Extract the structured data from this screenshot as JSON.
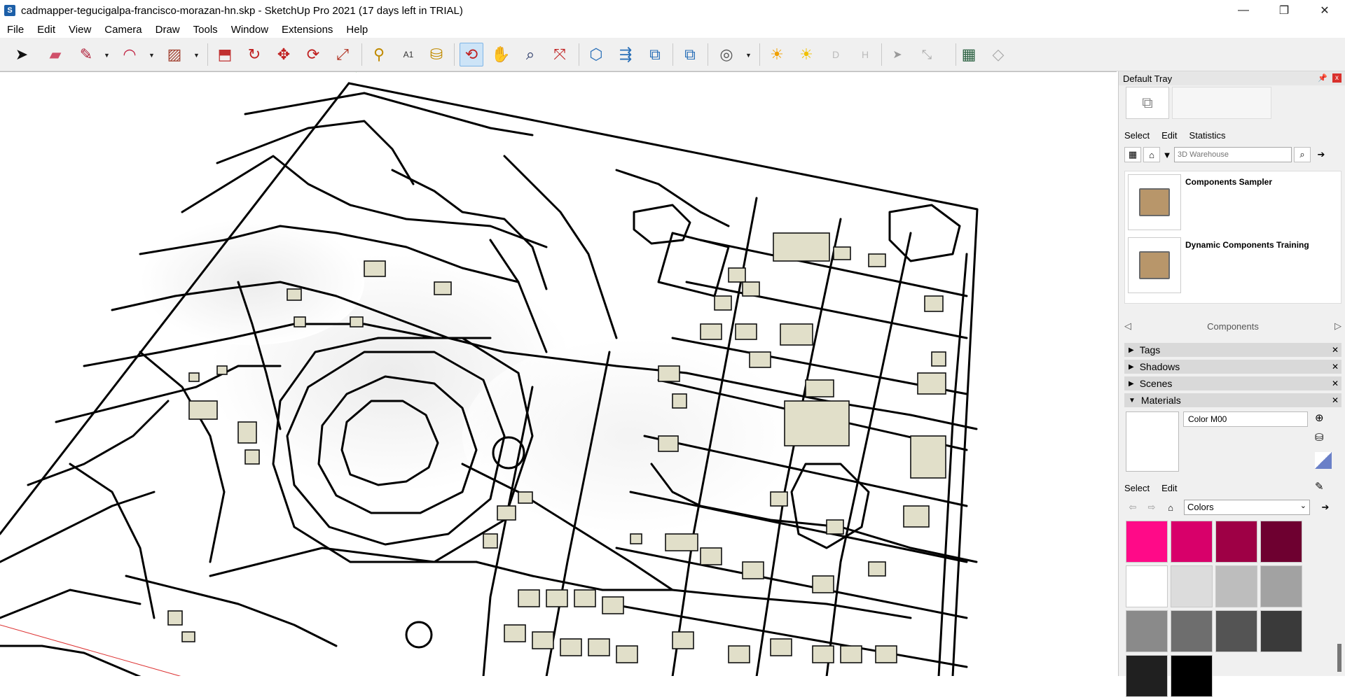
{
  "window": {
    "title": "cadmapper-tegucigalpa-francisco-morazan-hn.skp - SketchUp Pro 2021 (17 days left in TRIAL)",
    "app_icon": "S",
    "minimize": "—",
    "restore": "❐",
    "close": "✕"
  },
  "menu": {
    "items": [
      "File",
      "Edit",
      "View",
      "Camera",
      "Draw",
      "Tools",
      "Window",
      "Extensions",
      "Help"
    ]
  },
  "toolbar": {
    "tools": [
      {
        "name": "select-tool-icon",
        "glyph": "➤"
      },
      {
        "name": "eraser-tool-icon",
        "glyph": "▰"
      },
      {
        "name": "pencil-tool-icon",
        "glyph": "✎"
      },
      {
        "name": "arc-tool-icon",
        "glyph": "◠"
      },
      {
        "name": "rectangle-tool-icon",
        "glyph": "▨"
      },
      {
        "name": "push-pull-tool-icon",
        "glyph": "⬒"
      },
      {
        "name": "follow-me-tool-icon",
        "glyph": "↻"
      },
      {
        "name": "move-tool-icon",
        "glyph": "✥"
      },
      {
        "name": "rotate-tool-icon",
        "glyph": "⟳"
      },
      {
        "name": "scale-tool-icon",
        "glyph": "⤢"
      },
      {
        "name": "tape-measure-tool-icon",
        "glyph": "⚲"
      },
      {
        "name": "text-tool-icon",
        "glyph": "A1"
      },
      {
        "name": "paint-bucket-tool-icon",
        "glyph": "⛁"
      },
      {
        "name": "orbit-tool-icon",
        "glyph": "⟲"
      },
      {
        "name": "pan-tool-icon",
        "glyph": "✋"
      },
      {
        "name": "zoom-tool-icon",
        "glyph": "⌕"
      },
      {
        "name": "zoom-extents-tool-icon",
        "glyph": "⤧"
      },
      {
        "name": "3d-warehouse-icon",
        "glyph": "⬡"
      },
      {
        "name": "share-model-icon",
        "glyph": "⇶"
      },
      {
        "name": "extension-warehouse-icon",
        "glyph": "⧉"
      },
      {
        "name": "layout-send-icon",
        "glyph": "⧉"
      },
      {
        "name": "account-icon",
        "glyph": "◎"
      },
      {
        "name": "shadows-sun-icon",
        "glyph": "☀"
      },
      {
        "name": "fog-sun-icon",
        "glyph": "☀"
      },
      {
        "name": "d-icon",
        "glyph": "D"
      },
      {
        "name": "h-icon",
        "glyph": "H"
      },
      {
        "name": "cursor-icon",
        "glyph": "➤"
      },
      {
        "name": "line-icon",
        "glyph": "⤡"
      },
      {
        "name": "map-icon",
        "glyph": "▦"
      },
      {
        "name": "eraser-alt-icon",
        "glyph": "◇"
      }
    ]
  },
  "tray": {
    "title": "Default Tray",
    "pin": "📌",
    "close": "x",
    "components": {
      "tabs": [
        "Select",
        "Edit",
        "Statistics"
      ],
      "search_placeholder": "3D Warehouse",
      "items": [
        {
          "label": "Components Sampler"
        },
        {
          "label": "Dynamic Components Training"
        }
      ],
      "footer_label": "Components",
      "prev": "◁",
      "next": "▷"
    },
    "panels": [
      {
        "label": "Tags",
        "expanded": false
      },
      {
        "label": "Shadows",
        "expanded": false
      },
      {
        "label": "Scenes",
        "expanded": false
      },
      {
        "label": "Materials",
        "expanded": true
      }
    ],
    "materials": {
      "name_value": "Color M00",
      "tabs": [
        "Select",
        "Edit"
      ],
      "library": "Colors",
      "swatches": [
        "#ff0a88",
        "#d8006a",
        "#9e0045",
        "#6e0030",
        "#ffffff",
        "#dcdcdc",
        "#bdbdbd",
        "#a2a2a2",
        "#8a8a8a",
        "#6e6e6e",
        "#545454",
        "#3a3a3a",
        "#202020",
        "#000000"
      ]
    }
  }
}
